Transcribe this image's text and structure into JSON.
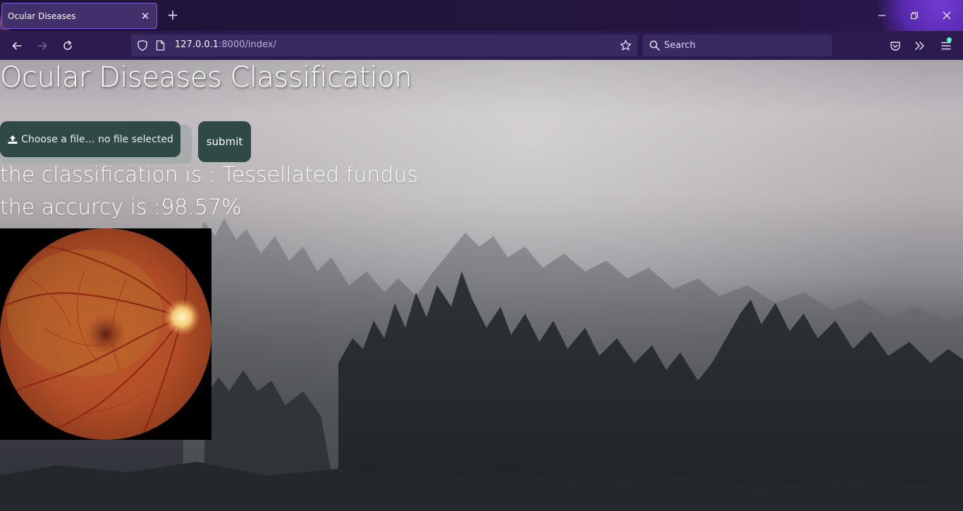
{
  "browser": {
    "tab_title": "Ocular Diseases",
    "tab_close": "✕",
    "new_tab": "+",
    "window": {
      "minimize": "—",
      "restore": "❐",
      "close": "✕"
    },
    "nav": {
      "back": "←",
      "forward": "→",
      "reload": "↻"
    },
    "url_host": "127.0.0.1",
    "url_rest": ":8000/index/",
    "search_placeholder": "Search",
    "icons": [
      "shield-icon",
      "page-icon",
      "star-icon",
      "search-icon",
      "pocket-icon",
      "overflow-chevron-icon",
      "menu-icon"
    ]
  },
  "page": {
    "title": "Ocular Diseases Classification",
    "file_button_label": "Choose a file… no file selected",
    "submit_label": "submit",
    "classification_text": "the classification is : Tessellated fundus",
    "accuracy_text": "the accurcy is :98.57%"
  },
  "colors": {
    "button_bg": "#2f4a46",
    "chrome_bg": "#2b1b4e",
    "tab_border": "#7f5bd6",
    "notification_dot": "#54ffbd"
  }
}
